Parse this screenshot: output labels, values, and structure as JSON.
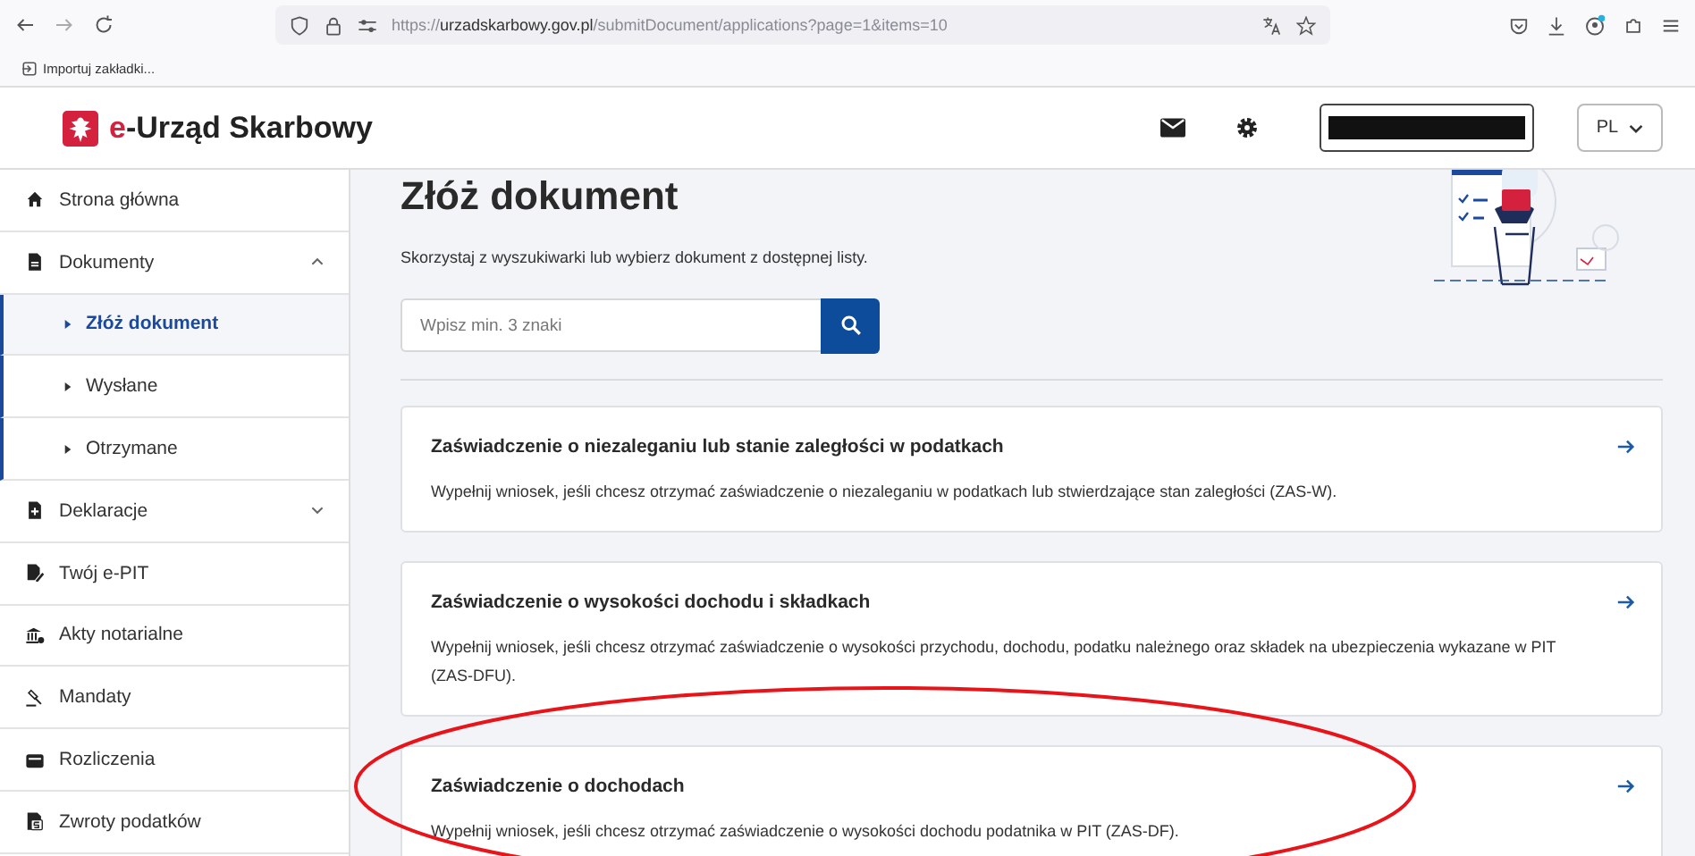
{
  "browser": {
    "url": "https://**urzadskarbowy.gov.pl**/submitDocument/applications?page=1&items=10",
    "bookmark": "Importuj zakładki..."
  },
  "header": {
    "logo_prefix": "e",
    "logo_text": "-Urząd Skarbowy",
    "language": "PL"
  },
  "sidebar": {
    "items": [
      {
        "label": "Strona główna",
        "kind": "link"
      },
      {
        "label": "Dokumenty",
        "kind": "group",
        "expanded": true,
        "children": [
          {
            "label": "Złóż dokument",
            "selected": true
          },
          {
            "label": "Wysłane",
            "selected": false
          },
          {
            "label": "Otrzymane",
            "selected": false
          }
        ]
      },
      {
        "label": "Deklaracje",
        "kind": "group",
        "expanded": false
      },
      {
        "label": "Twój e-PIT",
        "kind": "link"
      },
      {
        "label": "Akty notarialne",
        "kind": "link"
      },
      {
        "label": "Mandaty",
        "kind": "link"
      },
      {
        "label": "Rozliczenia",
        "kind": "link"
      },
      {
        "label": "Zwroty podatków",
        "kind": "link"
      }
    ]
  },
  "main": {
    "title": "Złóż dokument",
    "intro": "Skorzystaj z wyszukiwarki lub wybierz dokument z dostępnej listy.",
    "search": {
      "placeholder": "Wpisz min. 3 znaki"
    },
    "cards": [
      {
        "title": "Zaświadczenie o niezaleganiu lub stanie zaległości w podatkach",
        "description": "Wypełnij wniosek, jeśli chcesz otrzymać zaświadczenie o niezaleganiu w podatkach lub stwierdzające stan zaległości (ZAS-W)."
      },
      {
        "title": "Zaświadczenie o wysokości dochodu i składkach",
        "description": "Wypełnij wniosek, jeśli chcesz otrzymać zaświadczenie o wysokości przychodu, dochodu, podatku należnego oraz składek na ubezpieczenia wykazane w PIT (ZAS-DFU)."
      },
      {
        "title": "Zaświadczenie o dochodach",
        "description": "Wypełnij wniosek, jeśli chcesz otrzymać zaświadczenie o wysokości dochodu podatnika w PIT (ZAS-DF)."
      }
    ]
  }
}
